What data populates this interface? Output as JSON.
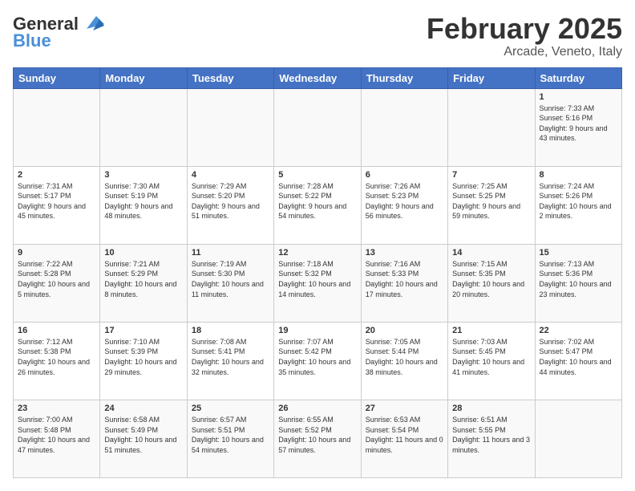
{
  "header": {
    "logo_line1": "General",
    "logo_line2": "Blue",
    "title": "February 2025",
    "subtitle": "Arcade, Veneto, Italy"
  },
  "days_of_week": [
    "Sunday",
    "Monday",
    "Tuesday",
    "Wednesday",
    "Thursday",
    "Friday",
    "Saturday"
  ],
  "weeks": [
    [
      {
        "day": "",
        "info": ""
      },
      {
        "day": "",
        "info": ""
      },
      {
        "day": "",
        "info": ""
      },
      {
        "day": "",
        "info": ""
      },
      {
        "day": "",
        "info": ""
      },
      {
        "day": "",
        "info": ""
      },
      {
        "day": "1",
        "info": "Sunrise: 7:33 AM\nSunset: 5:16 PM\nDaylight: 9 hours and 43 minutes."
      }
    ],
    [
      {
        "day": "2",
        "info": "Sunrise: 7:31 AM\nSunset: 5:17 PM\nDaylight: 9 hours and 45 minutes."
      },
      {
        "day": "3",
        "info": "Sunrise: 7:30 AM\nSunset: 5:19 PM\nDaylight: 9 hours and 48 minutes."
      },
      {
        "day": "4",
        "info": "Sunrise: 7:29 AM\nSunset: 5:20 PM\nDaylight: 9 hours and 51 minutes."
      },
      {
        "day": "5",
        "info": "Sunrise: 7:28 AM\nSunset: 5:22 PM\nDaylight: 9 hours and 54 minutes."
      },
      {
        "day": "6",
        "info": "Sunrise: 7:26 AM\nSunset: 5:23 PM\nDaylight: 9 hours and 56 minutes."
      },
      {
        "day": "7",
        "info": "Sunrise: 7:25 AM\nSunset: 5:25 PM\nDaylight: 9 hours and 59 minutes."
      },
      {
        "day": "8",
        "info": "Sunrise: 7:24 AM\nSunset: 5:26 PM\nDaylight: 10 hours and 2 minutes."
      }
    ],
    [
      {
        "day": "9",
        "info": "Sunrise: 7:22 AM\nSunset: 5:28 PM\nDaylight: 10 hours and 5 minutes."
      },
      {
        "day": "10",
        "info": "Sunrise: 7:21 AM\nSunset: 5:29 PM\nDaylight: 10 hours and 8 minutes."
      },
      {
        "day": "11",
        "info": "Sunrise: 7:19 AM\nSunset: 5:30 PM\nDaylight: 10 hours and 11 minutes."
      },
      {
        "day": "12",
        "info": "Sunrise: 7:18 AM\nSunset: 5:32 PM\nDaylight: 10 hours and 14 minutes."
      },
      {
        "day": "13",
        "info": "Sunrise: 7:16 AM\nSunset: 5:33 PM\nDaylight: 10 hours and 17 minutes."
      },
      {
        "day": "14",
        "info": "Sunrise: 7:15 AM\nSunset: 5:35 PM\nDaylight: 10 hours and 20 minutes."
      },
      {
        "day": "15",
        "info": "Sunrise: 7:13 AM\nSunset: 5:36 PM\nDaylight: 10 hours and 23 minutes."
      }
    ],
    [
      {
        "day": "16",
        "info": "Sunrise: 7:12 AM\nSunset: 5:38 PM\nDaylight: 10 hours and 26 minutes."
      },
      {
        "day": "17",
        "info": "Sunrise: 7:10 AM\nSunset: 5:39 PM\nDaylight: 10 hours and 29 minutes."
      },
      {
        "day": "18",
        "info": "Sunrise: 7:08 AM\nSunset: 5:41 PM\nDaylight: 10 hours and 32 minutes."
      },
      {
        "day": "19",
        "info": "Sunrise: 7:07 AM\nSunset: 5:42 PM\nDaylight: 10 hours and 35 minutes."
      },
      {
        "day": "20",
        "info": "Sunrise: 7:05 AM\nSunset: 5:44 PM\nDaylight: 10 hours and 38 minutes."
      },
      {
        "day": "21",
        "info": "Sunrise: 7:03 AM\nSunset: 5:45 PM\nDaylight: 10 hours and 41 minutes."
      },
      {
        "day": "22",
        "info": "Sunrise: 7:02 AM\nSunset: 5:47 PM\nDaylight: 10 hours and 44 minutes."
      }
    ],
    [
      {
        "day": "23",
        "info": "Sunrise: 7:00 AM\nSunset: 5:48 PM\nDaylight: 10 hours and 47 minutes."
      },
      {
        "day": "24",
        "info": "Sunrise: 6:58 AM\nSunset: 5:49 PM\nDaylight: 10 hours and 51 minutes."
      },
      {
        "day": "25",
        "info": "Sunrise: 6:57 AM\nSunset: 5:51 PM\nDaylight: 10 hours and 54 minutes."
      },
      {
        "day": "26",
        "info": "Sunrise: 6:55 AM\nSunset: 5:52 PM\nDaylight: 10 hours and 57 minutes."
      },
      {
        "day": "27",
        "info": "Sunrise: 6:53 AM\nSunset: 5:54 PM\nDaylight: 11 hours and 0 minutes."
      },
      {
        "day": "28",
        "info": "Sunrise: 6:51 AM\nSunset: 5:55 PM\nDaylight: 11 hours and 3 minutes."
      },
      {
        "day": "",
        "info": ""
      }
    ]
  ]
}
